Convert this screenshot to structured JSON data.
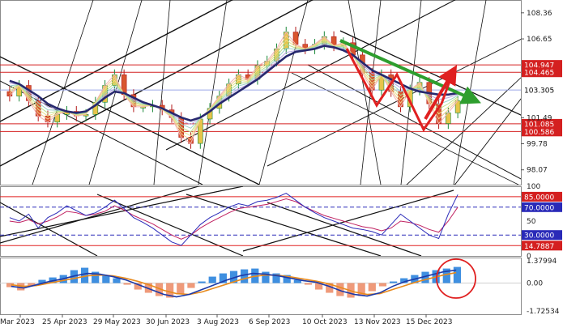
{
  "chart_data": [
    {
      "type": "candlestick",
      "panel": "price",
      "x_ticks": [
        "Mar 2023",
        "25 Apr 2023",
        "29 May 2023",
        "30 Jun 2023",
        "3 Aug 2023",
        "6 Sep 2023",
        "10 Oct 2023",
        "13 Nov 2023",
        "15 Dec 2023"
      ],
      "y_ticks": [
        108.36,
        106.65,
        104.947,
        104.465,
        103.305,
        101.49,
        101.085,
        100.586,
        99.78,
        98.07
      ],
      "ylim": [
        97.1,
        109.2
      ],
      "horizontal_levels": [
        {
          "value": 104.947,
          "label": "104.947",
          "color": "#d42020"
        },
        {
          "value": 104.465,
          "label": "104.465",
          "color": "#d42020"
        },
        {
          "value": 103.305,
          "label": "103.305",
          "color": "#9aa6e6"
        },
        {
          "value": 101.085,
          "label": "101.085",
          "color": "#d42020"
        },
        {
          "value": 100.586,
          "label": "100.586",
          "color": "#d42020"
        }
      ],
      "series": [
        {
          "name": "close",
          "values": [
            102.9,
            103.6,
            102.6,
            101.6,
            101.2,
            101.7,
            101.9,
            101.6,
            101.7,
            102.5,
            103.6,
            104.3,
            103.0,
            102.2,
            102.2,
            102.3,
            102.0,
            101.5,
            100.2,
            99.8,
            101.4,
            102.1,
            102.9,
            103.7,
            104.3,
            104.0,
            104.9,
            105.2,
            106.0,
            107.1,
            106.3,
            106.0,
            106.3,
            106.8,
            106.2,
            106.4,
            105.6,
            104.4,
            103.3,
            104.3,
            103.2,
            102.2,
            103.3,
            103.8,
            102.4,
            101.1,
            101.8,
            102.6
          ]
        },
        {
          "name": "slow_ma",
          "values": [
            103.9,
            103.7,
            103.3,
            102.9,
            102.4,
            102.1,
            101.9,
            101.8,
            101.9,
            102.3,
            102.8,
            103.2,
            103.1,
            102.8,
            102.5,
            102.3,
            102.1,
            101.8,
            101.5,
            101.3,
            101.5,
            101.9,
            102.4,
            102.8,
            103.2,
            103.6,
            104.0,
            104.5,
            105.0,
            105.5,
            105.8,
            105.9,
            106.0,
            106.2,
            106.1,
            105.9,
            105.6,
            105.1,
            104.6,
            104.3,
            104.0,
            103.7,
            103.4,
            103.2,
            103.1,
            103.0,
            103.0,
            103.1
          ]
        }
      ],
      "annotation_arrows": [
        {
          "color": "#2e9e2e",
          "from_date": "10 Oct 2023",
          "from_value": 106.55,
          "to_date": "end",
          "to_value": 102.7
        },
        {
          "color": "#e02020",
          "from_date": "15 Dec 2023",
          "from_value": 101.4,
          "to_date": "end",
          "to_value": 104.4
        }
      ]
    },
    {
      "type": "line",
      "panel": "oscillator",
      "y_ticks": [
        100,
        85.0,
        70.0,
        50,
        30.0,
        14.7887,
        0
      ],
      "tag_labels": [
        "85.0000",
        "70.0000",
        "30.0000",
        "14.7887"
      ],
      "ylim": [
        0,
        100
      ],
      "levels": [
        85,
        70,
        30,
        14.7887
      ],
      "series": [
        {
          "name": "fast",
          "values": [
            55,
            50,
            60,
            40,
            55,
            62,
            72,
            65,
            58,
            62,
            70,
            80,
            68,
            55,
            48,
            40,
            30,
            20,
            15,
            30,
            45,
            55,
            62,
            70,
            75,
            72,
            78,
            80,
            84,
            90,
            80,
            70,
            62,
            55,
            50,
            45,
            40,
            38,
            35,
            30,
            45,
            60,
            50,
            40,
            30,
            25,
            60,
            88
          ]
        },
        {
          "name": "slow",
          "values": [
            50,
            48,
            52,
            46,
            50,
            56,
            64,
            62,
            58,
            60,
            64,
            72,
            66,
            58,
            52,
            46,
            38,
            30,
            24,
            30,
            40,
            48,
            55,
            62,
            68,
            70,
            72,
            74,
            78,
            82,
            78,
            70,
            64,
            58,
            54,
            50,
            46,
            42,
            40,
            36,
            40,
            50,
            48,
            44,
            38,
            34,
            50,
            70
          ]
        }
      ]
    },
    {
      "type": "bar",
      "panel": "macd",
      "y_ticks": [
        1.37994,
        0.0,
        -1.72534
      ],
      "ylim": [
        -1.72534,
        1.37994
      ],
      "histogram": [
        -0.25,
        -0.45,
        -0.2,
        0.2,
        0.35,
        0.5,
        0.8,
        0.95,
        0.7,
        0.5,
        0.3,
        -0.1,
        -0.4,
        -0.6,
        -0.8,
        -0.9,
        -0.7,
        -0.3,
        0.1,
        0.4,
        0.6,
        0.75,
        0.85,
        0.9,
        0.7,
        0.6,
        0.5,
        0.2,
        -0.1,
        -0.4,
        -0.6,
        -0.8,
        -0.9,
        -0.8,
        -0.5,
        -0.2,
        0.1,
        0.3,
        0.5,
        0.7,
        0.8,
        0.9,
        1.0
      ],
      "series": [
        {
          "name": "macd",
          "values": [
            -0.2,
            -0.3,
            -0.1,
            0.1,
            0.25,
            0.45,
            0.6,
            0.55,
            0.4,
            0.2,
            -0.1,
            -0.4,
            -0.7,
            -0.85,
            -0.7,
            -0.4,
            -0.1,
            0.2,
            0.45,
            0.6,
            0.55,
            0.45,
            0.3,
            0.15,
            0.05,
            -0.2,
            -0.5,
            -0.7,
            -0.8,
            -0.6,
            -0.2,
            0.1,
            0.3,
            0.5,
            0.7,
            0.8
          ]
        },
        {
          "name": "signal",
          "values": [
            -0.1,
            -0.2,
            -0.15,
            0.0,
            0.15,
            0.3,
            0.45,
            0.5,
            0.45,
            0.3,
            0.1,
            -0.15,
            -0.45,
            -0.65,
            -0.7,
            -0.55,
            -0.3,
            -0.05,
            0.2,
            0.4,
            0.5,
            0.48,
            0.38,
            0.25,
            0.12,
            -0.05,
            -0.3,
            -0.55,
            -0.7,
            -0.65,
            -0.4,
            -0.15,
            0.1,
            0.3,
            0.5,
            0.65
          ]
        }
      ],
      "annotation": {
        "shape": "circle",
        "color": "#e02020"
      }
    }
  ]
}
